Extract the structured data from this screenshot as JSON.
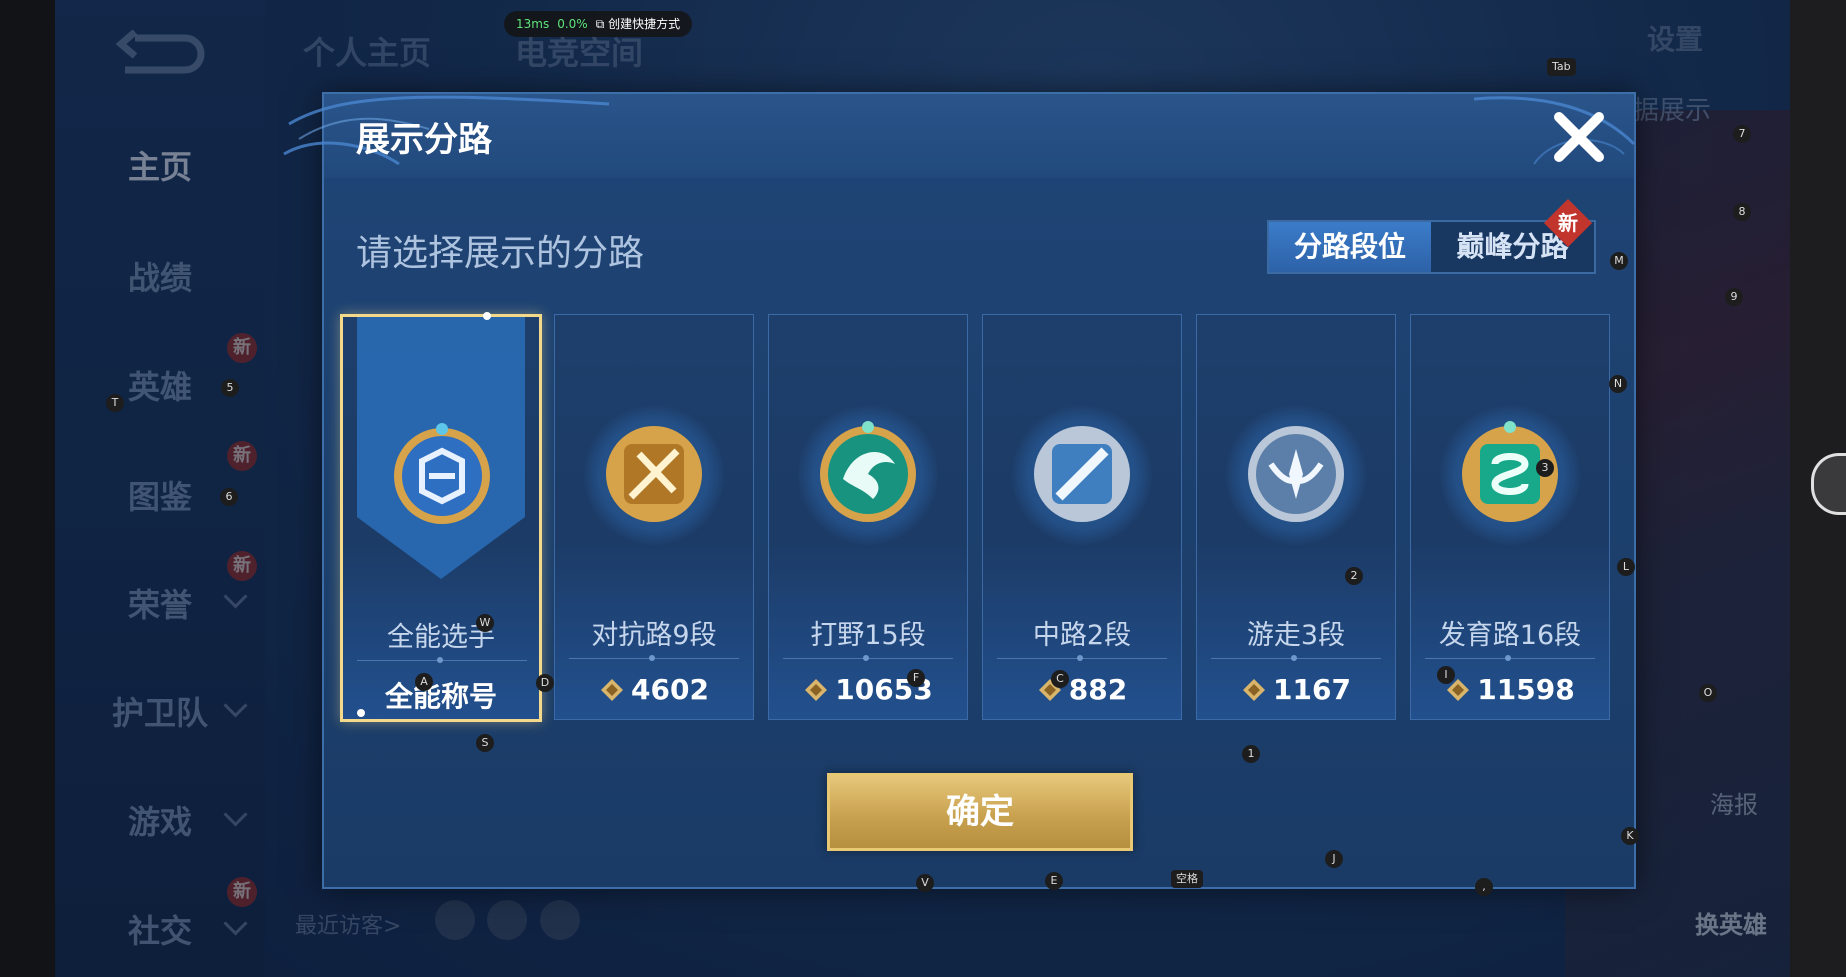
{
  "perf": {
    "latency": "13ms",
    "percent": "0.0%",
    "shortcut": "创建快捷方式"
  },
  "background": {
    "top_tabs": [
      "个人主页",
      "电竞空间"
    ],
    "settings": "设置",
    "right_text": "和数据展示",
    "visitors_label": "最近访客>",
    "poster_label": "海报",
    "switch_hero_label": "换英雄"
  },
  "sidebar": {
    "items": [
      {
        "label": "主页",
        "active": true
      },
      {
        "label": "战绩"
      },
      {
        "label": "英雄",
        "badge": "新"
      },
      {
        "label": "图鉴",
        "badge": "新"
      },
      {
        "label": "荣誉",
        "badge": "新"
      },
      {
        "label": "护卫队"
      },
      {
        "label": "游戏"
      },
      {
        "label": "社交",
        "badge": "新"
      }
    ]
  },
  "dialog": {
    "title": "展示分路",
    "prompt": "请选择展示的分路",
    "tabs": {
      "active": "分路段位",
      "inactive": "巅峰分路",
      "new_badge": "新"
    },
    "confirm_label": "确定",
    "cards": [
      {
        "role": "全能选手",
        "score": "全能称号",
        "selected": true,
        "emblem": "all-round-emblem-icon",
        "color": "#2f6fc1"
      },
      {
        "role": "对抗路9段",
        "score": "4602",
        "emblem": "clash-lane-emblem-icon",
        "color": "#c98a35"
      },
      {
        "role": "打野15段",
        "score": "10653",
        "emblem": "jungle-emblem-icon",
        "color": "#1aa38e"
      },
      {
        "role": "中路2段",
        "score": "882",
        "emblem": "mid-lane-emblem-icon",
        "color": "#4d89c4"
      },
      {
        "role": "游走3段",
        "score": "1167",
        "emblem": "roam-emblem-icon",
        "color": "#7f9fc4"
      },
      {
        "role": "发育路16段",
        "score": "11598",
        "emblem": "farm-lane-emblem-icon",
        "color": "#18b08f"
      }
    ]
  },
  "key_hints": [
    "Tab",
    "7",
    "8",
    "M",
    "9",
    "N",
    "3",
    "2",
    "L",
    "O",
    "1",
    "K",
    "J",
    "空格",
    "E",
    "V",
    "S",
    "W",
    "A",
    "D",
    "F",
    "C",
    "I",
    "5",
    "T",
    "6",
    ","
  ]
}
